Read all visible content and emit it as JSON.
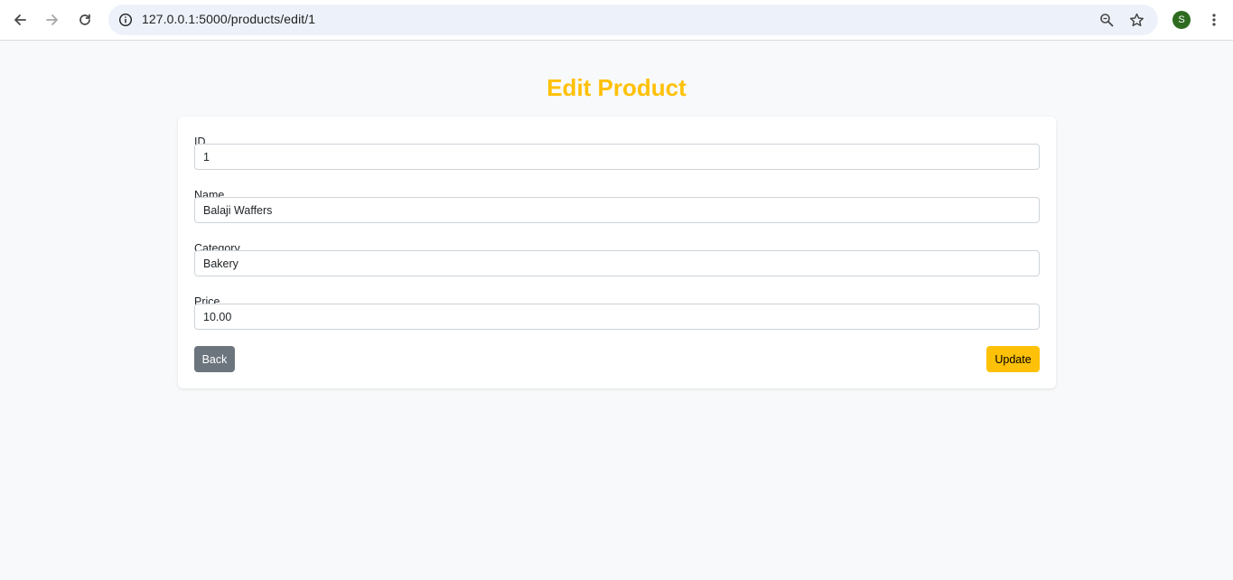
{
  "browser": {
    "url": "127.0.0.1:5000/products/edit/1",
    "profile_initial": "S",
    "icons": {
      "back": "arrow-left-icon",
      "forward": "arrow-right-icon",
      "reload": "reload-icon",
      "site_info": "info-icon",
      "zoom": "zoom-icon",
      "bookmark": "star-icon",
      "menu": "kebab-menu-icon"
    }
  },
  "page": {
    "title": "Edit Product",
    "title_color": "#ffc107"
  },
  "form": {
    "fields": [
      {
        "label": "ID",
        "value": "1"
      },
      {
        "label": "Name",
        "value": "Balaji Waffers"
      },
      {
        "label": "Category",
        "value": "Bakery"
      },
      {
        "label": "Price",
        "value": "10.00"
      }
    ],
    "back_label": "Back",
    "update_label": "Update"
  },
  "colors": {
    "accent": "#ffc107",
    "secondary": "#6c757d",
    "background": "#f8f9fa"
  }
}
